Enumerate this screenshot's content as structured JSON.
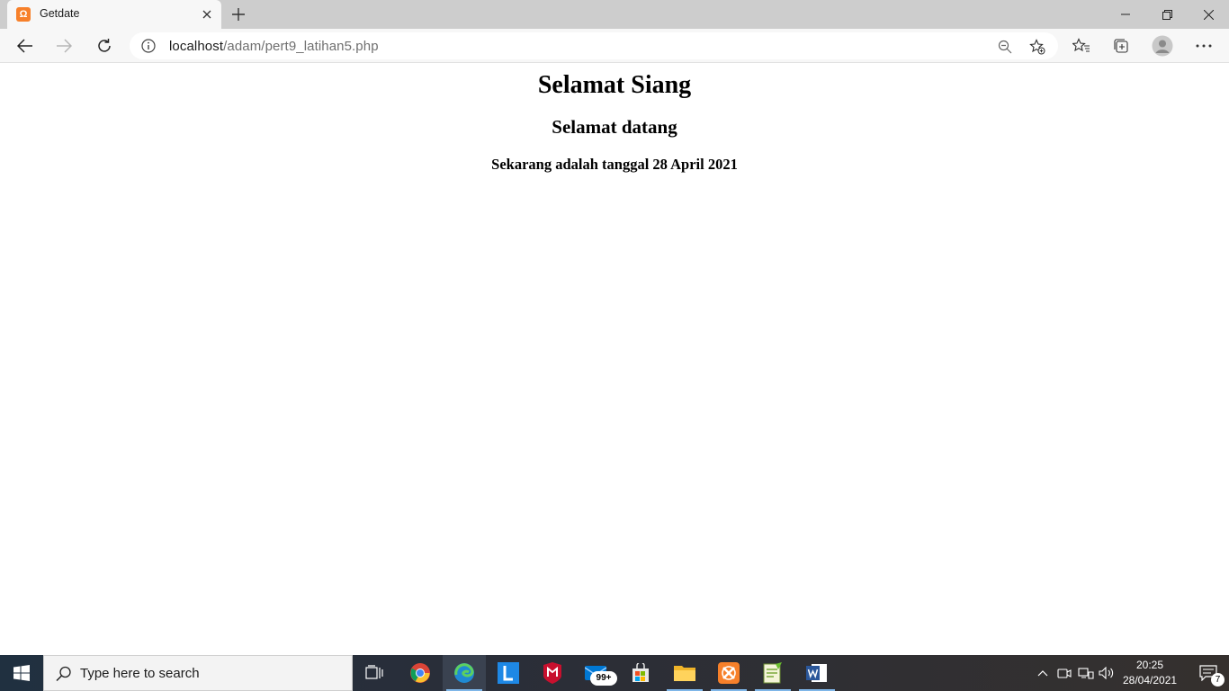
{
  "browser": {
    "tab": {
      "title": "Getdate",
      "favicon_letter": "Ω"
    },
    "address": {
      "host": "localhost",
      "path": "/adam/pert9_latihan5.php"
    }
  },
  "page": {
    "heading1": "Selamat Siang",
    "heading2": "Selamat datang",
    "heading3": "Sekarang adalah tanggal 28 April 2021"
  },
  "taskbar": {
    "search_placeholder": "Type here to search",
    "mail_badge": "99+",
    "notification_count": "7",
    "clock_time": "20:25",
    "clock_date": "28/04/2021"
  },
  "colors": {
    "tab_strip": "#cdcdcd",
    "toolbar": "#f7f7f7",
    "xampp_orange": "#f7802a",
    "word_blue": "#2b579a"
  }
}
